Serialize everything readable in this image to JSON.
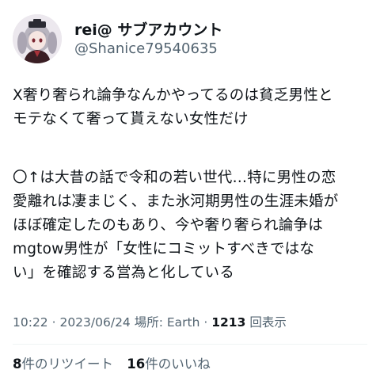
{
  "user": {
    "display_name": "rei@ サブアカウント",
    "handle": "@Shanice79540635"
  },
  "tweet": {
    "lines_para1": [
      "X奢り奢られ論争なんかやってるのは貧乏男性と",
      "モテなくて奢って貰えない女性だけ"
    ],
    "lines_para2": [
      "〇↑は大昔の話で令和の若い世代…特に男性の恋",
      "愛離れは凄まじく、また氷河期男性の生涯未婚が",
      "ほぼ確定したのもあり、今や奢り奢られ論争は",
      "mgtow男性が「女性にコミットすべきではな",
      "い」を確認する営為と化している"
    ]
  },
  "meta": {
    "time": "10:22",
    "separator": " · ",
    "date": "2023/06/24",
    "location": "場所: Earth",
    "views_count": "1213",
    "views_label": "回表示"
  },
  "stats": {
    "retweets_count": "8",
    "retweets_label": "件のリツイート",
    "likes_count": "16",
    "likes_label": "件のいいね"
  },
  "colors": {
    "text": "#0f1419",
    "secondary": "#536471",
    "divider": "#eff3f4"
  }
}
